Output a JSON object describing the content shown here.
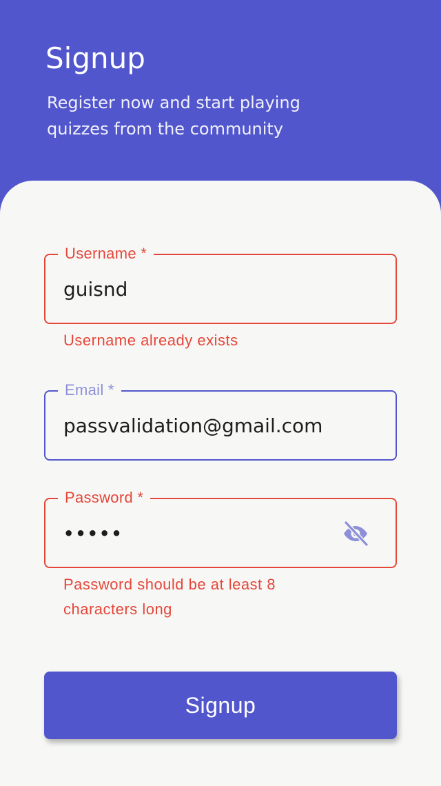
{
  "header": {
    "title": "Signup",
    "subtitle": "Register now and start playing quizzes from the community"
  },
  "form": {
    "username": {
      "label": "Username *",
      "value": "guisnd",
      "error": "Username already exists",
      "state": "error"
    },
    "email": {
      "label": "Email *",
      "value": "passvalidation@gmail.com",
      "state": "focused"
    },
    "password": {
      "label": "Password *",
      "value": "•••••",
      "error": "Password should be at least 8 characters long",
      "state": "error",
      "toggle_icon": "eye-off-icon"
    },
    "submit_label": "Signup"
  },
  "colors": {
    "primary": "#5256cc",
    "error": "#e5463a",
    "background": "#f7f8f6",
    "label_focused": "#8d90d8"
  }
}
